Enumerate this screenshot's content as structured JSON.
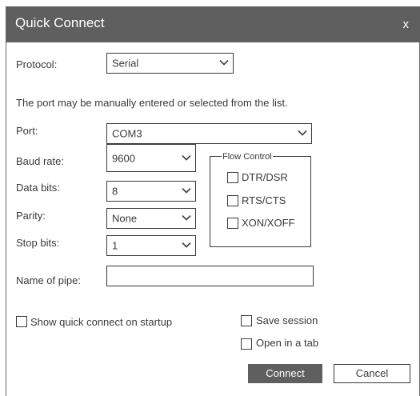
{
  "window": {
    "title": "Quick Connect",
    "close_label": "x"
  },
  "protocol": {
    "label": "Protocol:",
    "value": "Serial"
  },
  "hint": "The port may be manually entered or selected from the list.",
  "port": {
    "label": "Port:",
    "value": "COM3"
  },
  "baud_rate": {
    "label": "Baud rate:",
    "value": "9600"
  },
  "data_bits": {
    "label": "Data bits:",
    "value": "8"
  },
  "parity": {
    "label": "Parity:",
    "value": "None"
  },
  "stop_bits": {
    "label": "Stop bits:",
    "value": "1"
  },
  "flow_control": {
    "title": "Flow Control",
    "options": [
      {
        "label": "DTR/DSR",
        "checked": false
      },
      {
        "label": "RTS/CTS",
        "checked": false
      },
      {
        "label": "XON/XOFF",
        "checked": false
      }
    ]
  },
  "pipe": {
    "label": "Name of pipe:",
    "value": ""
  },
  "options": {
    "show_on_startup": "Show quick connect on startup",
    "save_session": "Save session",
    "open_in_tab": "Open in a tab"
  },
  "buttons": {
    "connect": "Connect",
    "cancel": "Cancel"
  },
  "colors": {
    "titlebar": "#5f5f5f",
    "primary_button": "#5f5f5f",
    "text": "#3a3a3a"
  }
}
